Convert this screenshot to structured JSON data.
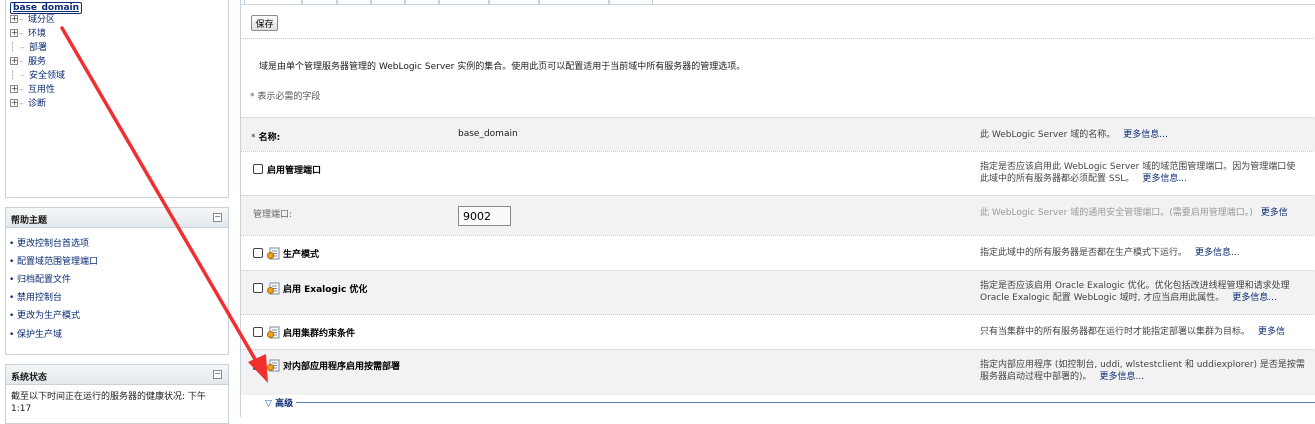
{
  "tree": {
    "root": "base_domain",
    "items": [
      {
        "label": "域分区",
        "expandable": true
      },
      {
        "label": "环境",
        "expandable": true
      },
      {
        "label": "部署",
        "expandable": false
      },
      {
        "label": "服务",
        "expandable": true
      },
      {
        "label": "安全领域",
        "expandable": false
      },
      {
        "label": "互用性",
        "expandable": true
      },
      {
        "label": "诊断",
        "expandable": true
      }
    ]
  },
  "help": {
    "title": "帮助主题",
    "items": [
      "更改控制台首选项",
      "配置域范围管理端口",
      "归档配置文件",
      "禁用控制台",
      "更改为生产模式",
      "保护生产域"
    ]
  },
  "system_status": {
    "title": "系统状态",
    "text": "截至以下时间正在运行的服务器的健康状况: 下午1:17"
  },
  "toolbar": {
    "save": "保存"
  },
  "description": "域是由单个管理服务器管理的 WebLogic Server 实例的集合。使用此页可以配置适用于当前域中所有服务器的管理选项。",
  "required_note": "* 表示必需的字段",
  "fields": [
    {
      "label": "名称:",
      "required": true,
      "value": "base_domain",
      "hint": "此 WebLogic Server 域的名称。",
      "more": "更多信息..."
    },
    {
      "label": "启用管理端口",
      "checkbox": true,
      "checked": false,
      "hint_lines": [
        "指定是否应该启用此 WebLogic Server 域的域范围管理端口。因为管理端口使",
        "此域中的所有服务器都必须配置 SSL。"
      ],
      "more": "更多信息..."
    },
    {
      "label": "管理端口:",
      "disabled": true,
      "value": "9002",
      "hint": "此 WebLogic Server 域的通用安全管理端口。(需要启用管理端口。)",
      "more": "更多信"
    },
    {
      "label": "生产模式",
      "checkbox": true,
      "checked": false,
      "icon": "config-icon",
      "hint": "指定此域中的所有服务器是否都在生产模式下运行。",
      "more": "更多信息..."
    },
    {
      "label": "启用 Exalogic 优化",
      "checkbox": true,
      "checked": false,
      "icon": "config-icon",
      "hint_lines": [
        "指定是否应该启用 Oracle Exalogic 优化。优化包括改进线程管理和请求处理",
        "Oracle Exalogic 配置 WebLogic 域时, 才应当启用此属性。"
      ],
      "more": "更多信息..."
    },
    {
      "label": "启用集群约束条件",
      "checkbox": true,
      "checked": false,
      "icon": "config-icon",
      "hint": "只有当集群中的所有服务器都在运行时才能指定部署以集群为目标。",
      "more": "更多信"
    },
    {
      "label": "对内部应用程序启用按需部署",
      "checkbox": true,
      "checked": true,
      "icon": "config-icon",
      "hint_lines": [
        "指定内部应用程序 (如控制台, uddi, wlstestclient 和 uddiexplorer) 是否是按需",
        "服务器启动过程中部署的)。"
      ],
      "more": "更多信息..."
    }
  ],
  "advanced": "高级",
  "colors": {
    "link": "#0b2a73",
    "arrow": "#f03030",
    "panel_border": "#c7d2da"
  }
}
